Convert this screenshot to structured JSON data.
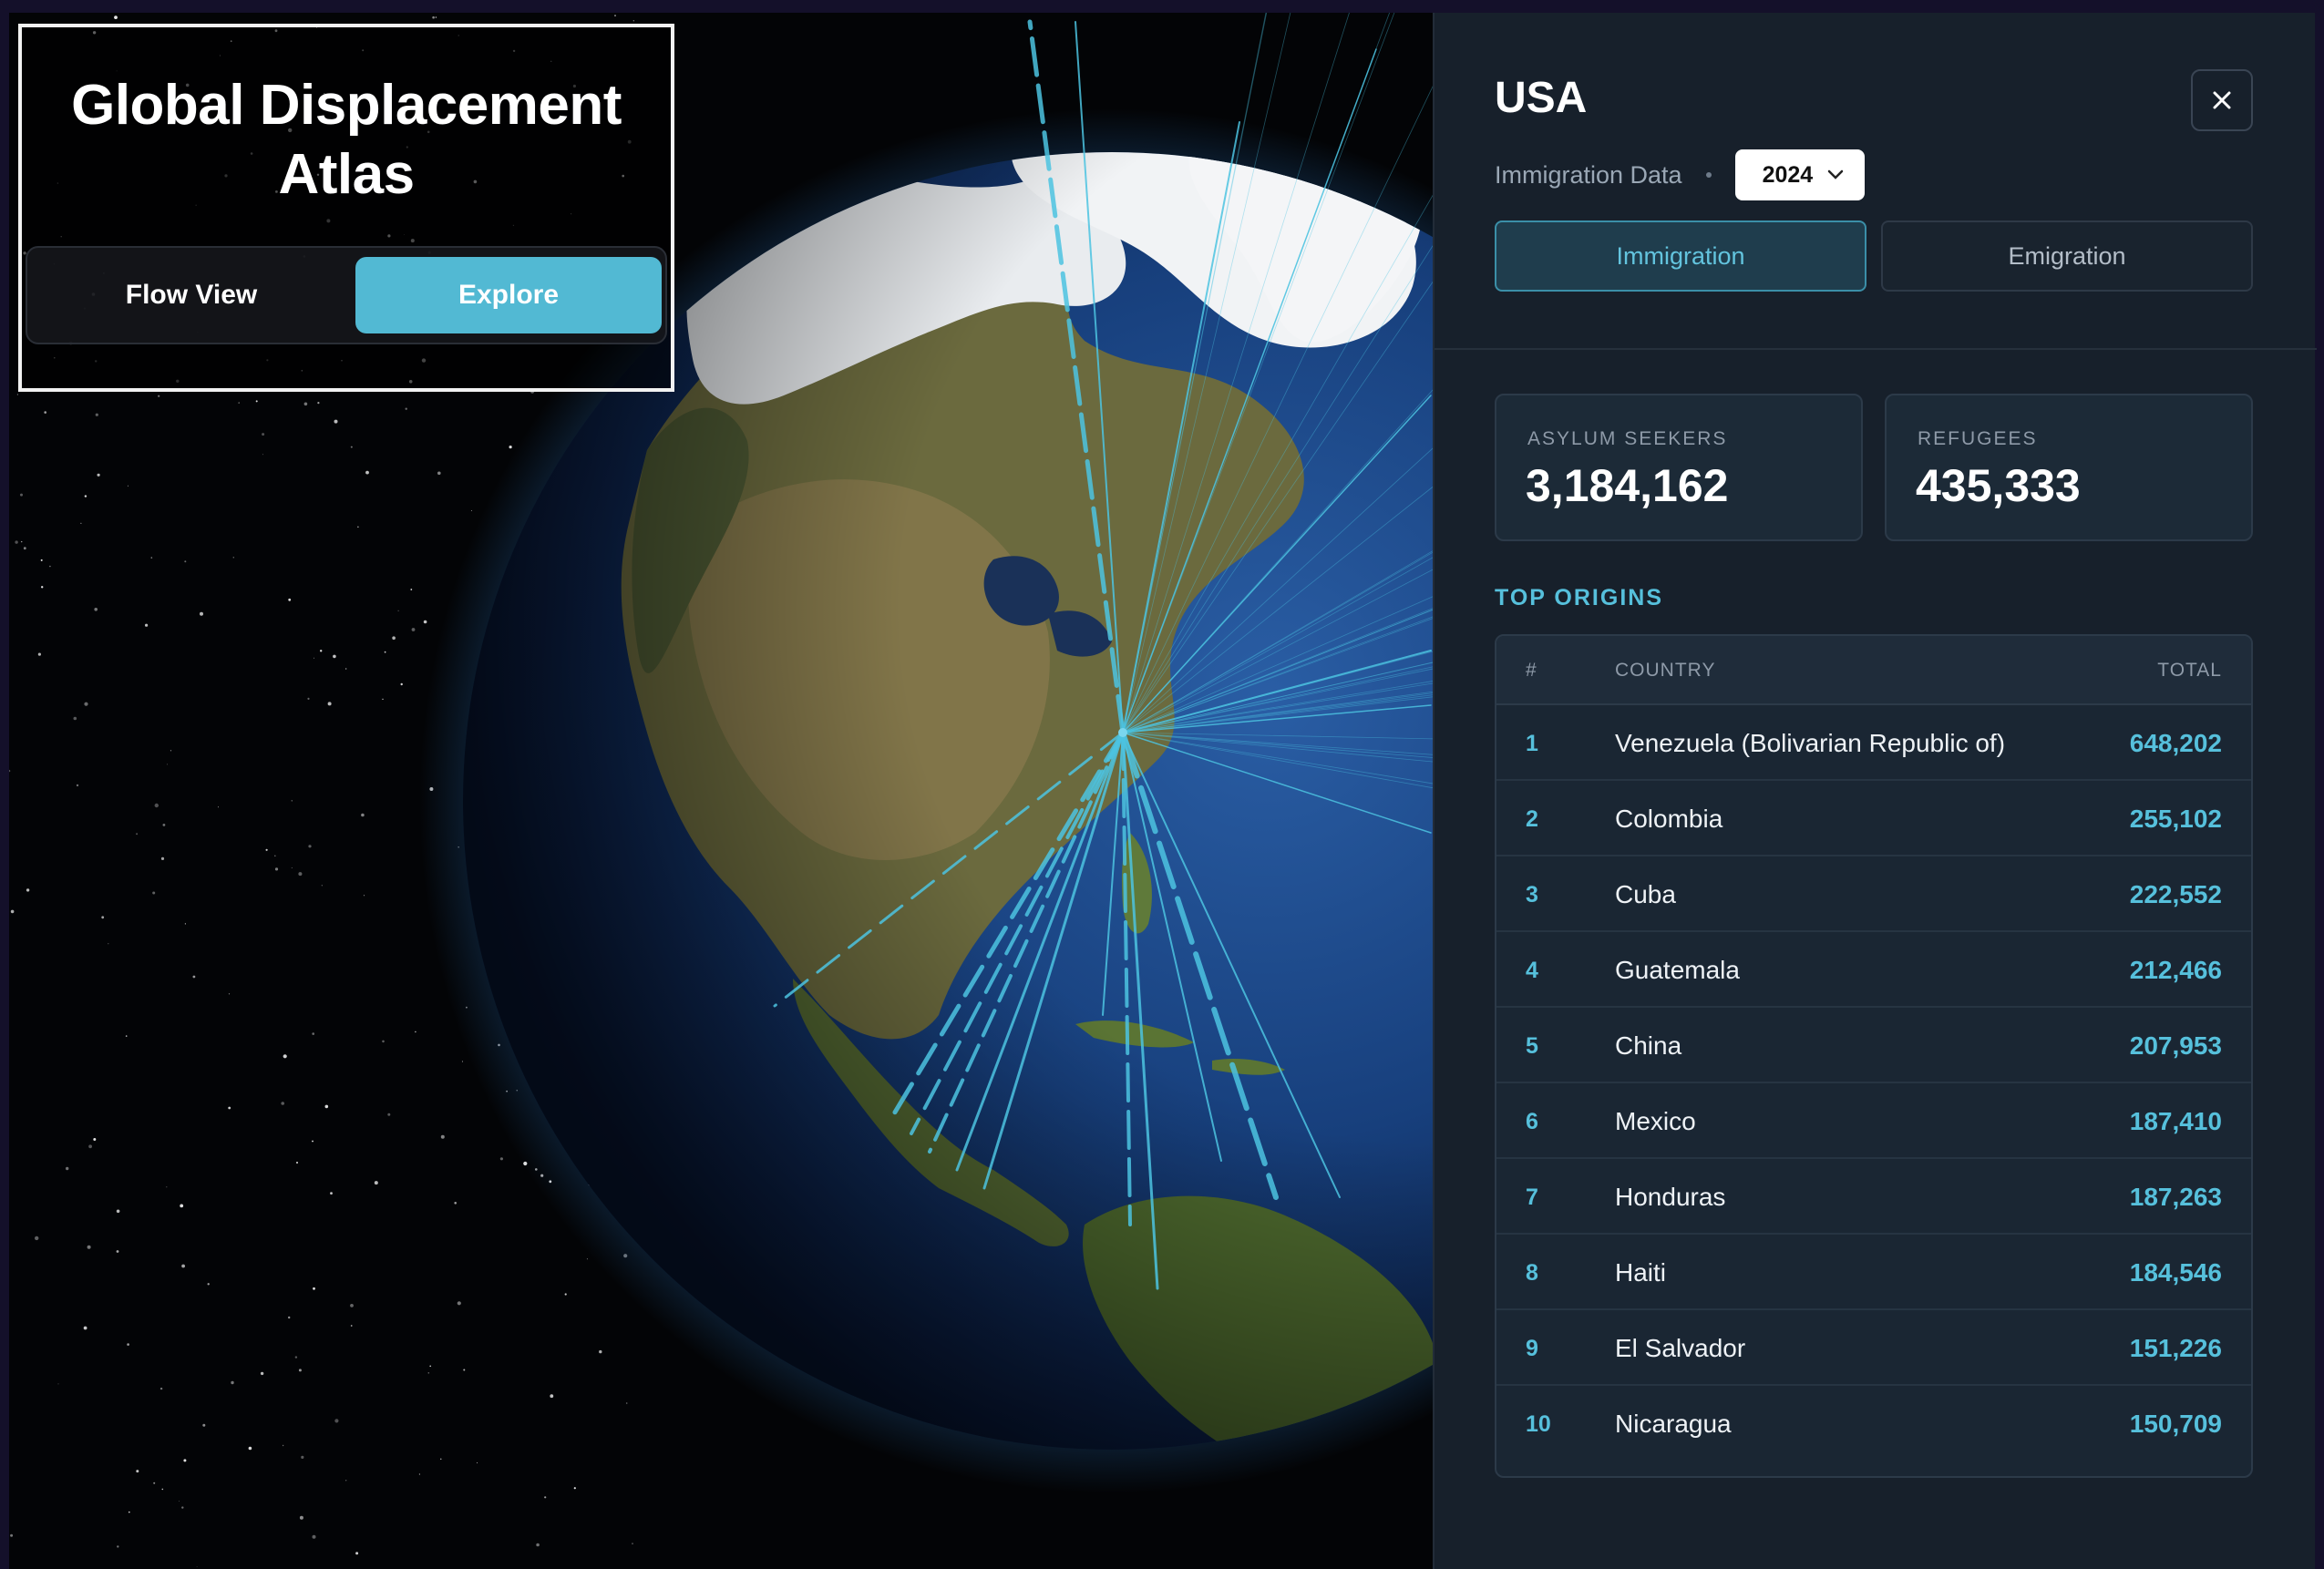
{
  "app": {
    "title": "Global Displacement Atlas",
    "view_toggle": {
      "flow_view": "Flow View",
      "explore": "Explore",
      "active": "Explore"
    }
  },
  "colors": {
    "accent": "#52b9d3",
    "panel_bg": "#17202b",
    "space_bg": "#030406",
    "flow_line": "#4cc3e0"
  },
  "panel": {
    "country": "USA",
    "subtitle": "Immigration Data",
    "year": "2024",
    "close_icon": "close-icon",
    "tabs": [
      {
        "label": "Immigration",
        "active": true
      },
      {
        "label": "Emigration",
        "active": false
      }
    ],
    "stats": {
      "asylum_label": "ASYLUM SEEKERS",
      "asylum_value": "3,184,162",
      "refugees_label": "REFUGEES",
      "refugees_value": "435,333"
    },
    "top_origins": {
      "heading": "TOP ORIGINS",
      "columns": {
        "rank": "#",
        "country": "COUNTRY",
        "total": "TOTAL"
      },
      "rows": [
        {
          "rank": "1",
          "country": "Venezuela (Bolivarian Republic of)",
          "total": "648,202"
        },
        {
          "rank": "2",
          "country": "Colombia",
          "total": "255,102"
        },
        {
          "rank": "3",
          "country": "Cuba",
          "total": "222,552"
        },
        {
          "rank": "4",
          "country": "Guatemala",
          "total": "212,466"
        },
        {
          "rank": "5",
          "country": "China",
          "total": "207,953"
        },
        {
          "rank": "6",
          "country": "Mexico",
          "total": "187,410"
        },
        {
          "rank": "7",
          "country": "Honduras",
          "total": "187,263"
        },
        {
          "rank": "8",
          "country": "Haiti",
          "total": "184,546"
        },
        {
          "rank": "9",
          "country": "El Salvador",
          "total": "151,226"
        },
        {
          "rank": "10",
          "country": "Nicaragua",
          "total": "150,709"
        }
      ]
    }
  }
}
